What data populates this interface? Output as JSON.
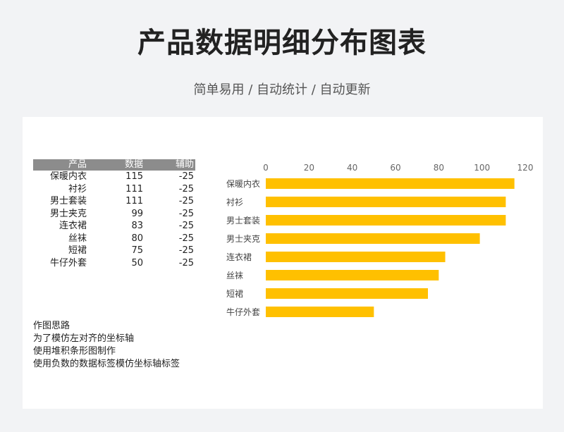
{
  "header": {
    "title": "产品数据明细分布图表",
    "subtitle": "简单易用 / 自动统计 / 自动更新"
  },
  "table": {
    "headers": [
      "产品",
      "数据",
      "辅助"
    ],
    "rows": [
      [
        "保暖内衣",
        "115",
        "-25"
      ],
      [
        "衬衫",
        "111",
        "-25"
      ],
      [
        "男士套装",
        "111",
        "-25"
      ],
      [
        "男士夹克",
        "99",
        "-25"
      ],
      [
        "连衣裙",
        "83",
        "-25"
      ],
      [
        "丝袜",
        "80",
        "-25"
      ],
      [
        "短裙",
        "75",
        "-25"
      ],
      [
        "牛仔外套",
        "50",
        "-25"
      ]
    ]
  },
  "notes": [
    "作图思路",
    "为了模仿左对齐的坐标轴",
    "使用堆积条形图制作",
    "使用负数的数据标签模仿坐标轴标签"
  ],
  "chart_data": {
    "type": "bar",
    "orientation": "horizontal",
    "categories": [
      "保暖内衣",
      "衬衫",
      "男士套装",
      "男士夹克",
      "连衣裙",
      "丝袜",
      "短裙",
      "牛仔外套"
    ],
    "values": [
      115,
      111,
      111,
      99,
      83,
      80,
      75,
      50
    ],
    "xlim": [
      0,
      120
    ],
    "xticks": [
      "0",
      "20",
      "40",
      "60",
      "80",
      "100",
      "120"
    ],
    "axis_position": "top",
    "grid": false,
    "bar_color": "#ffc000"
  }
}
